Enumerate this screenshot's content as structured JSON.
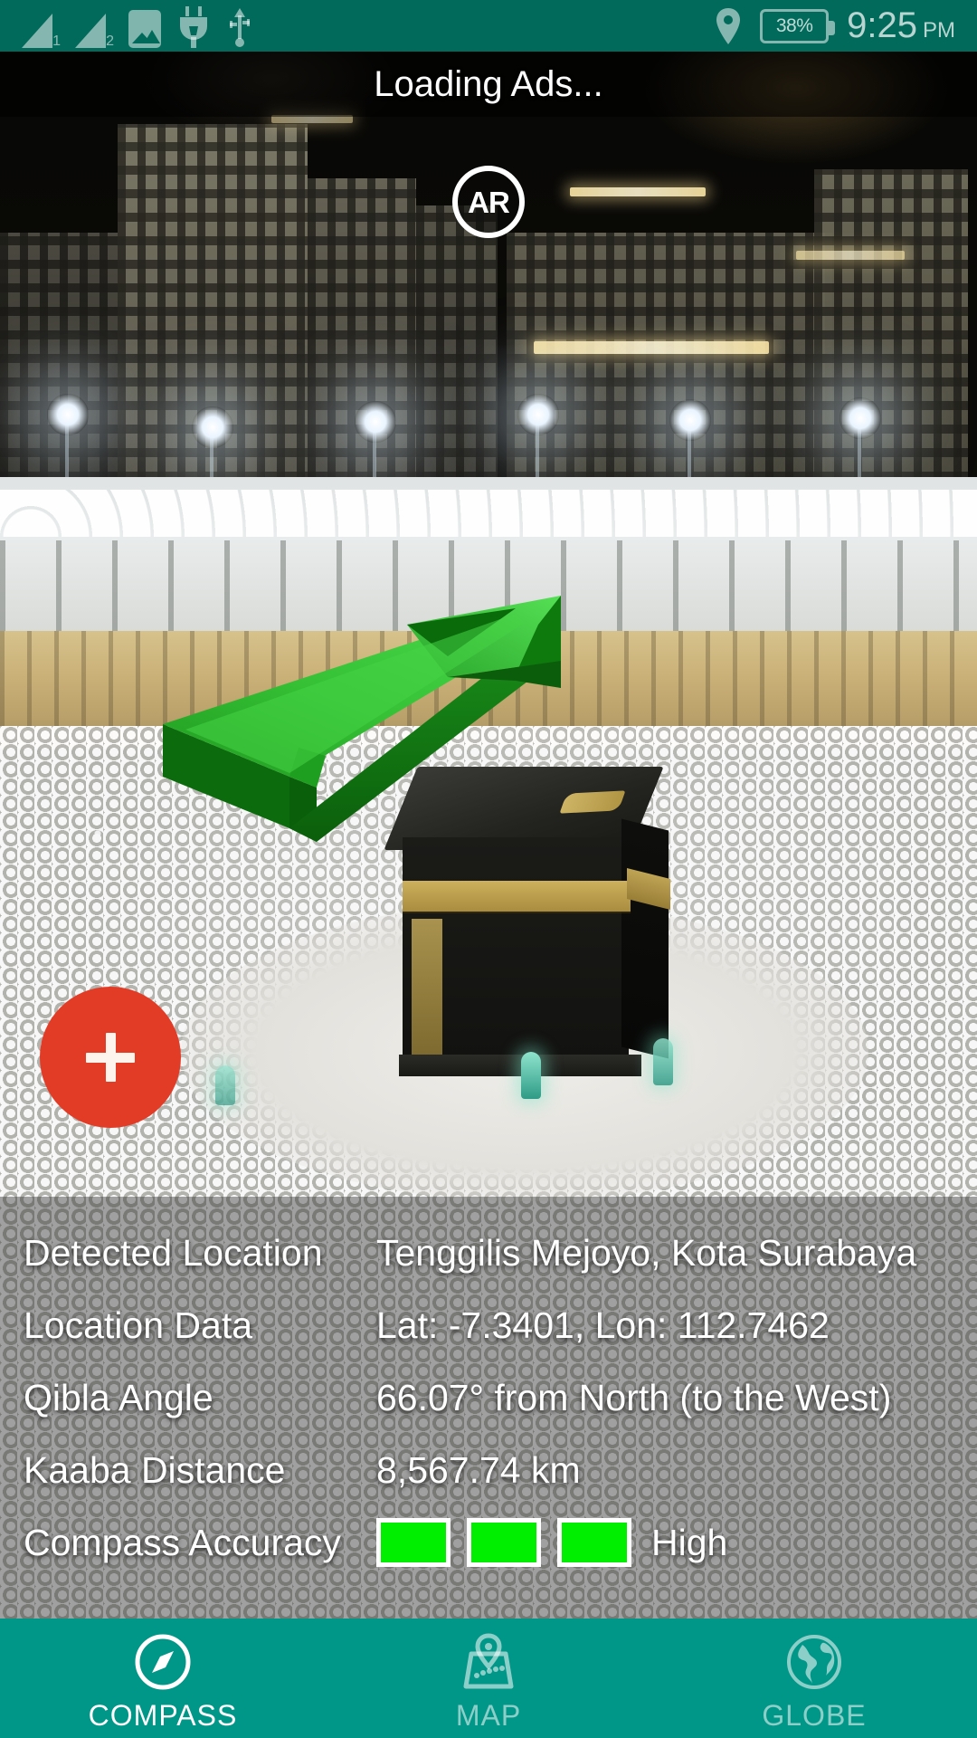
{
  "status_bar": {
    "background_color": "#016A5B",
    "left_icons": [
      {
        "name": "signal-bars-1-icon",
        "label": "1"
      },
      {
        "name": "signal-bars-2-icon",
        "label": "2"
      },
      {
        "name": "image-icon",
        "label": ""
      },
      {
        "name": "power-plug-icon",
        "label": ""
      },
      {
        "name": "usb-icon",
        "label": ""
      }
    ],
    "location_icon": "location-pin-icon",
    "battery_percent": "38%",
    "time": "9:25",
    "am_pm": "PM"
  },
  "ad_banner": {
    "text": "Loading Ads..."
  },
  "ar_button": {
    "label": "AR"
  },
  "fab": {
    "icon": "plus-icon",
    "color": "#e23b26"
  },
  "qibla_arrow": {
    "color_light": "#3ecb3e",
    "color_mid": "#22a222",
    "color_dark": "#0d7a0d",
    "direction": "up-right"
  },
  "info_panel": {
    "rows": [
      {
        "label": "Detected Location",
        "value": "Tenggilis Mejoyo, Kota Surabaya"
      },
      {
        "label": "Location Data",
        "value": "Lat: -7.3401, Lon: 112.7462"
      },
      {
        "label": "Qibla Angle",
        "value": "66.07° from North (to the West)"
      },
      {
        "label": "Kaaba Distance",
        "value": "8,567.74 km"
      }
    ],
    "accuracy": {
      "label": "Compass Accuracy",
      "value": "High",
      "bar_count": 3,
      "bar_color": "#00ee00"
    }
  },
  "bottom_nav": {
    "background_color": "#009688",
    "items": [
      {
        "label": "COMPASS",
        "icon": "compass-icon",
        "active": true
      },
      {
        "label": "MAP",
        "icon": "map-pin-icon",
        "active": false
      },
      {
        "label": "GLOBE",
        "icon": "globe-icon",
        "active": false
      }
    ]
  }
}
